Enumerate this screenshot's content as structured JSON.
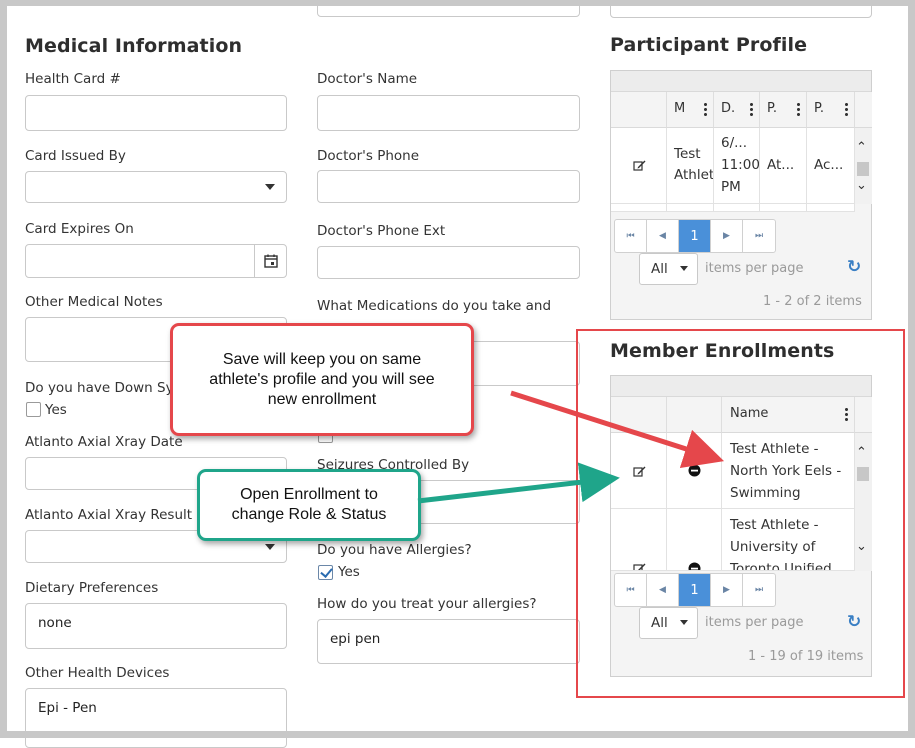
{
  "medical": {
    "title": "Medical Information",
    "health_card_label": "Health Card #",
    "card_issued_label": "Card Issued By",
    "card_expires_label": "Card Expires On",
    "other_notes_label": "Other Medical Notes",
    "down_syndrome_label": "Do you have Down Sync",
    "down_syndrome_option": "Yes",
    "xray_date_label": "Atlanto Axial Xray Date",
    "xray_result_label": "Atlanto Axial Xray Result",
    "dietary_label": "Dietary Preferences",
    "dietary_value": "none",
    "health_devices_label": "Other Health Devices",
    "health_devices_value": "Epi - Pen",
    "doctor_name_label": "Doctor's Name",
    "doctor_phone_label": "Doctor's Phone",
    "doctor_phone_ext_label": "Doctor's Phone Ext",
    "medications_label": "What Medications do you take and",
    "seizures_label": "Seizures Controlled By",
    "allergies_label": "Do you have Allergies?",
    "allergies_option": "Yes",
    "allergies_checked": true,
    "treat_allergies_label": "How do you treat your allergies?",
    "treat_allergies_value": "epi pen"
  },
  "participant_profile": {
    "title": "Participant Profile",
    "columns": [
      "M",
      "D.",
      "P.",
      "P."
    ],
    "row": {
      "col1": "Test Athlet",
      "col2": "6/... 11:00 PM",
      "col3": "At...",
      "col4": "Ac..."
    },
    "pager": {
      "first": "⏮",
      "prev": "◀",
      "page": "1",
      "next": "▶",
      "last": "⏭"
    },
    "page_size": "All",
    "page_size_label": "items per page",
    "summary": "1 - 2 of 2 items"
  },
  "member_enrollments": {
    "title": "Member Enrollments",
    "name_column": "Name",
    "rows": [
      {
        "name": "Test Athlete - North York Eels - Swimming"
      },
      {
        "name": "Test Athlete - University of Toronto Unified"
      }
    ],
    "pager": {
      "first": "⏮",
      "prev": "◀",
      "page": "1",
      "next": "▶",
      "last": "⏭"
    },
    "page_size": "All",
    "page_size_label": "items per page",
    "summary": "1 - 19 of 19 items"
  },
  "callouts": {
    "save": "Save will keep you on same athlete's profile and you will see new enrollment",
    "open": "Open Enrollment to change Role & Status"
  },
  "colors": {
    "red_callout": "#e5474b",
    "green_callout": "#1fa58a",
    "accent_blue": "#4a90d9"
  }
}
